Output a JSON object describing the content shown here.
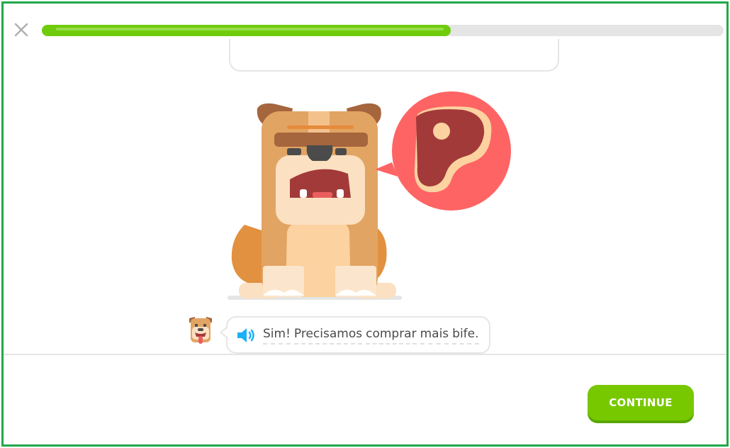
{
  "header": {
    "close_icon": "close-icon",
    "progress_percent": 60
  },
  "dialogue": {
    "speaker_icon": "speaker-icon",
    "words": [
      "Sim!",
      "Precisamos",
      "comprar",
      "mais",
      "bife."
    ]
  },
  "footer": {
    "continue_label": "CONTINUE"
  },
  "colors": {
    "accent_green": "#78c800",
    "progress_green": "#6fcc0c",
    "frame_border": "#22a84a"
  }
}
